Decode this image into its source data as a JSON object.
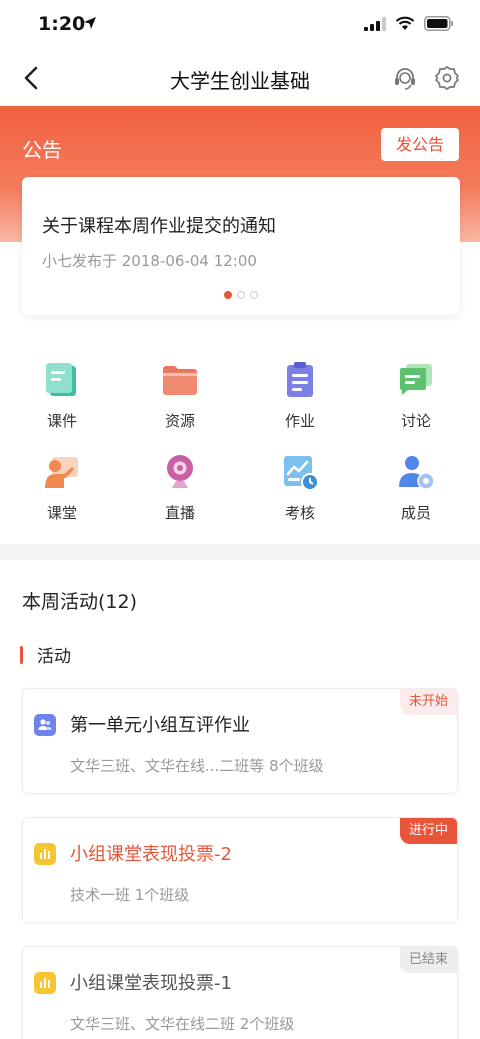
{
  "status_bar": {
    "time": "1:20"
  },
  "nav": {
    "title": "大学生创业基础"
  },
  "notice": {
    "header_title": "公告",
    "post_button": "发公告",
    "card_title": "关于课程本周作业提交的通知",
    "card_meta": "小七发布于  2018-06-04 12:00",
    "active_dot": 1,
    "dot_count": 3
  },
  "features": [
    {
      "label": "课件",
      "icon": "courseware-icon"
    },
    {
      "label": "资源",
      "icon": "folder-icon"
    },
    {
      "label": "作业",
      "icon": "clipboard-icon"
    },
    {
      "label": "讨论",
      "icon": "discussion-icon"
    },
    {
      "label": "课堂",
      "icon": "classroom-icon"
    },
    {
      "label": "直播",
      "icon": "webcam-icon"
    },
    {
      "label": "考核",
      "icon": "chart-clock-icon"
    },
    {
      "label": "成员",
      "icon": "member-icon"
    }
  ],
  "activity": {
    "week_title": "本周活动(12)",
    "section_label": "活动",
    "items": [
      {
        "title": "第一单元小组互评作业",
        "subtitle": "文华三班、文华在线...二班等  8个班级",
        "status": "未开始",
        "icon": "group-icon"
      },
      {
        "title": "小组课堂表现投票-2",
        "subtitle": "技术一班  1个班级",
        "status": "进行中",
        "icon": "vote-icon"
      },
      {
        "title": "小组课堂表现投票-1",
        "subtitle": "文华三班、文华在线二班  2个班级",
        "status": "已结束",
        "icon": "vote-icon"
      }
    ]
  },
  "colors": {
    "accent": "#e9553a",
    "header_top": "#f1613f"
  }
}
